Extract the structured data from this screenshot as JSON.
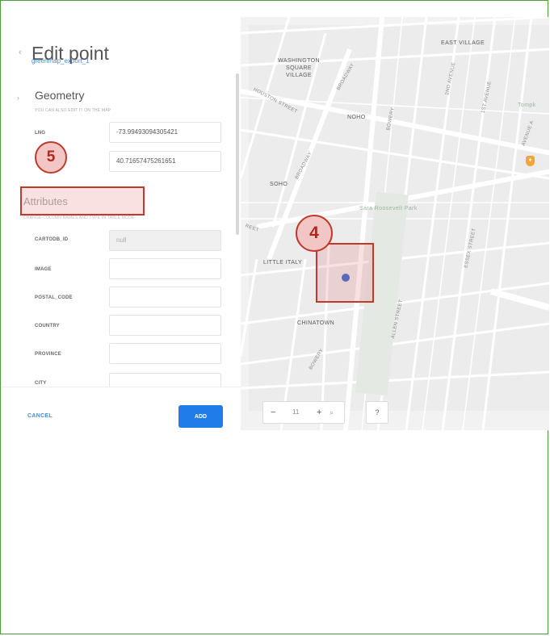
{
  "panel": {
    "title": "Edit point",
    "subtitle": "greenmap_export_1",
    "back_icon": "chevron-left-icon",
    "geometry": {
      "title": "Geometry",
      "hint": "YOU CAN ALSO EDIT IT ON THE MAP",
      "lng_label": "LNG",
      "lng_value": "-73.99493094305421",
      "lat_value": "40.71657475261651"
    },
    "attributes": {
      "title": "Attributes",
      "hint": "CHANGE COLUMN NAMES AND TYPE IN TABLE MODE",
      "fields": [
        {
          "label": "CARTODB_ID",
          "value": "null",
          "disabled": true
        },
        {
          "label": "IMAGE",
          "value": ""
        },
        {
          "label": "POSTAL_CODE",
          "value": ""
        },
        {
          "label": "COUNTRY",
          "value": ""
        },
        {
          "label": "PROVINCE",
          "value": ""
        },
        {
          "label": "CITY",
          "value": ""
        }
      ]
    },
    "footer": {
      "cancel_label": "CANCEL",
      "add_label": "ADD"
    }
  },
  "annotations": {
    "badge_attributes": "5",
    "badge_point": "4"
  },
  "map": {
    "labels": {
      "east_village": "EAST VILLAGE",
      "washington_square": "WASHINGTON\nSQUARE\nVILLAGE",
      "noho": "NOHO",
      "soho": "SOHO",
      "little_italy": "LITTLE ITALY",
      "chinatown": "CHINATOWN",
      "park": "Sara Roosevelt Park",
      "tompkins": "Tompk",
      "houston": "HOUSTON STREET",
      "broadway": "BROADWAY",
      "bowery": "BOWERY",
      "second_ave": "2ND AVENUE",
      "first_ave": "1ST AVENUE",
      "avenue_a": "AVENUE A",
      "allen": "ALLEN STREET",
      "essex": "ESSEX STREET",
      "bowery_south": "BOWERY",
      "street_frag": "REET",
      "broadway2": "BROADWAY"
    },
    "controls": {
      "zoom_out": "−",
      "zoom_level": "11",
      "zoom_in": "+",
      "search_icon": "search-icon",
      "help": "?"
    },
    "colors": {
      "point": "#3d6fd1",
      "highlight": "#c0392b",
      "add_button": "#1f7ce8",
      "link": "#4a8bd8"
    }
  }
}
